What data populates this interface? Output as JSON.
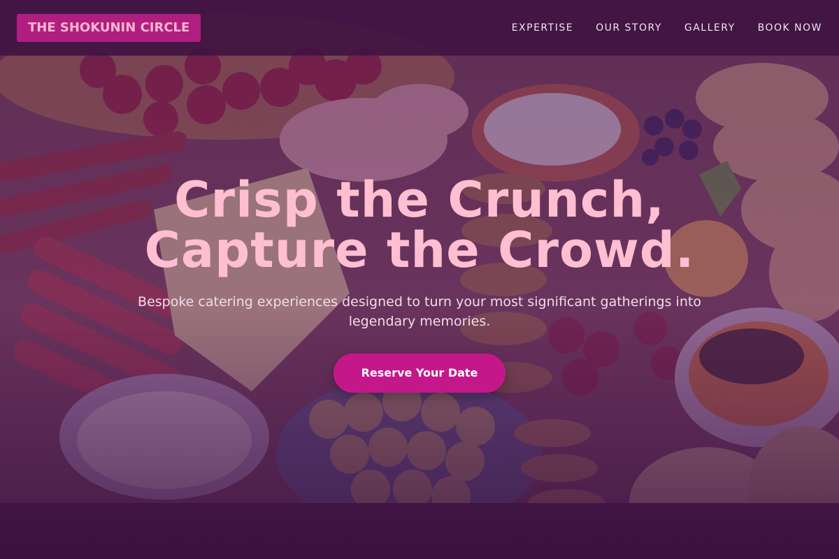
{
  "brand": {
    "name": "THE SHOKUNIN CIRCLE"
  },
  "nav": {
    "items": [
      {
        "label": "EXPERTISE"
      },
      {
        "label": "OUR STORY"
      },
      {
        "label": "GALLERY"
      },
      {
        "label": "BOOK NOW"
      }
    ]
  },
  "hero": {
    "headline_line1": "Crisp the Crunch,",
    "headline_line2": "Capture the Crowd.",
    "subtitle": "Bespoke catering experiences designed to turn your most significant gatherings into legendary memories.",
    "cta_label": "Reserve Your Date"
  },
  "colors": {
    "accent": "#c4188a",
    "headline": "#ffbfd1",
    "overlay": "#4a164e"
  }
}
